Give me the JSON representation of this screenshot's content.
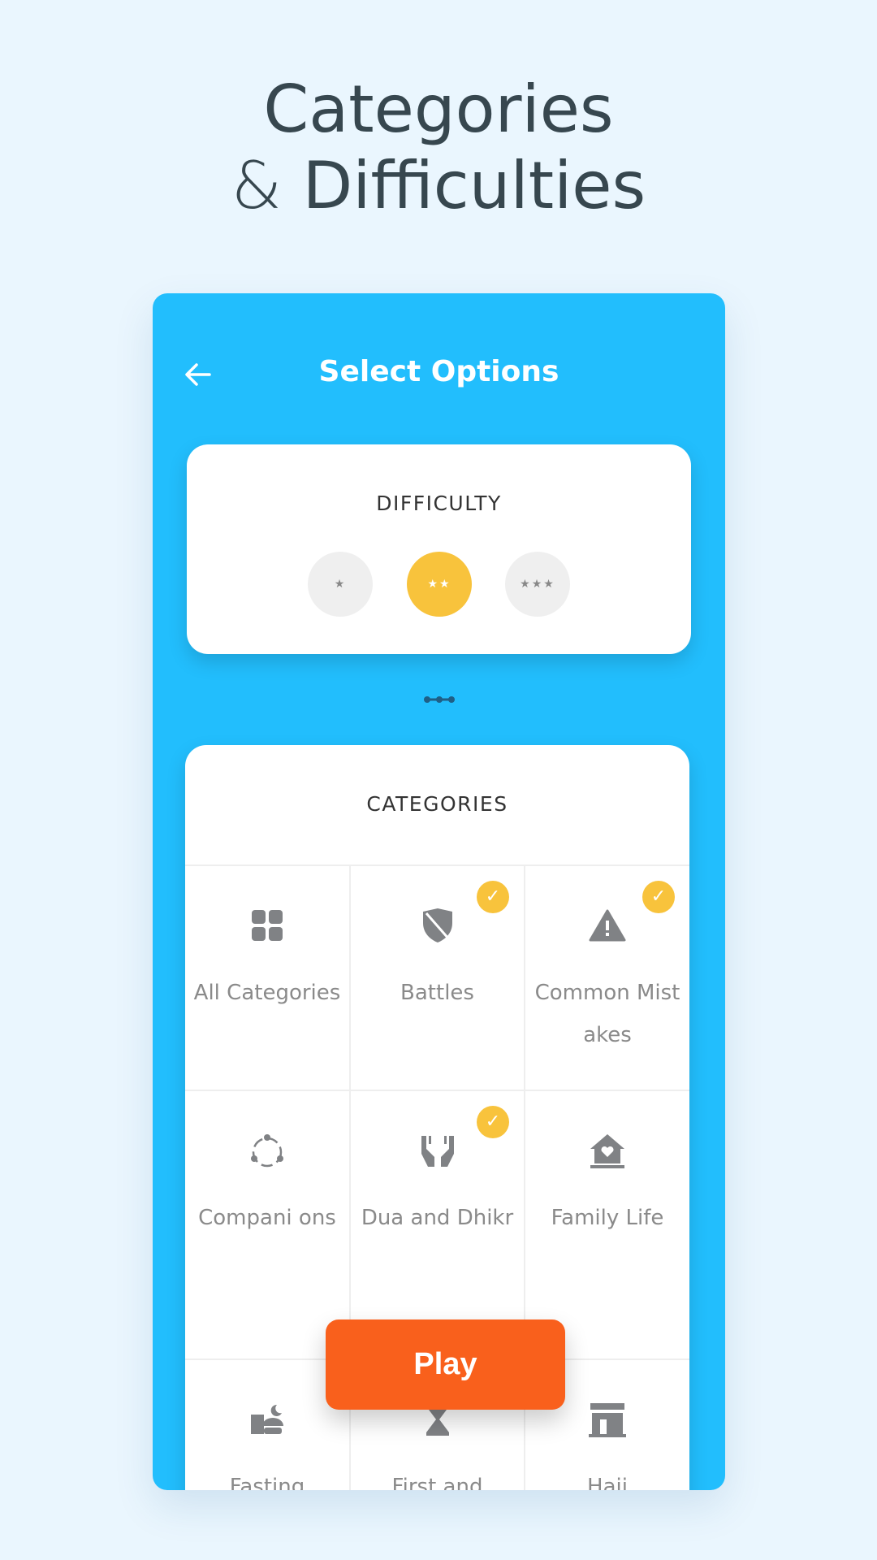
{
  "headline": {
    "line1": "Categories",
    "amp": "&",
    "line2": "Difficulties"
  },
  "header": {
    "title": "Select Options",
    "back_icon": "arrow-left-icon"
  },
  "difficulty": {
    "label": "DIFFICULTY",
    "levels": [
      {
        "stars": "★",
        "selected": false
      },
      {
        "stars": "★★",
        "selected": true
      },
      {
        "stars": "★★★",
        "selected": false
      }
    ]
  },
  "categories": {
    "label": "CATEGORIES",
    "items": [
      {
        "label": "All Categories",
        "icon": "grid-icon",
        "checked": false
      },
      {
        "label": "Battles",
        "icon": "shield-sword-icon",
        "checked": true
      },
      {
        "label": "Common Mistakes",
        "icon": "warning-icon",
        "checked": true
      },
      {
        "label": "Compani ons",
        "icon": "circle-nodes-icon",
        "checked": false
      },
      {
        "label": "Dua and Dhikr",
        "icon": "praying-hands-icon",
        "checked": true
      },
      {
        "label": "Family Life",
        "icon": "house-heart-icon",
        "checked": false
      },
      {
        "label": "Fasting",
        "icon": "food-moon-icon",
        "checked": false
      },
      {
        "label": "First and",
        "icon": "hourglass-icon",
        "checked": false
      },
      {
        "label": "Hajj",
        "icon": "kaaba-icon",
        "checked": false
      }
    ]
  },
  "play_label": "Play",
  "colors": {
    "panel": "#22BEFD",
    "accent": "#F8C33C",
    "play": "#F9601C",
    "background": "#EAF6FE"
  }
}
